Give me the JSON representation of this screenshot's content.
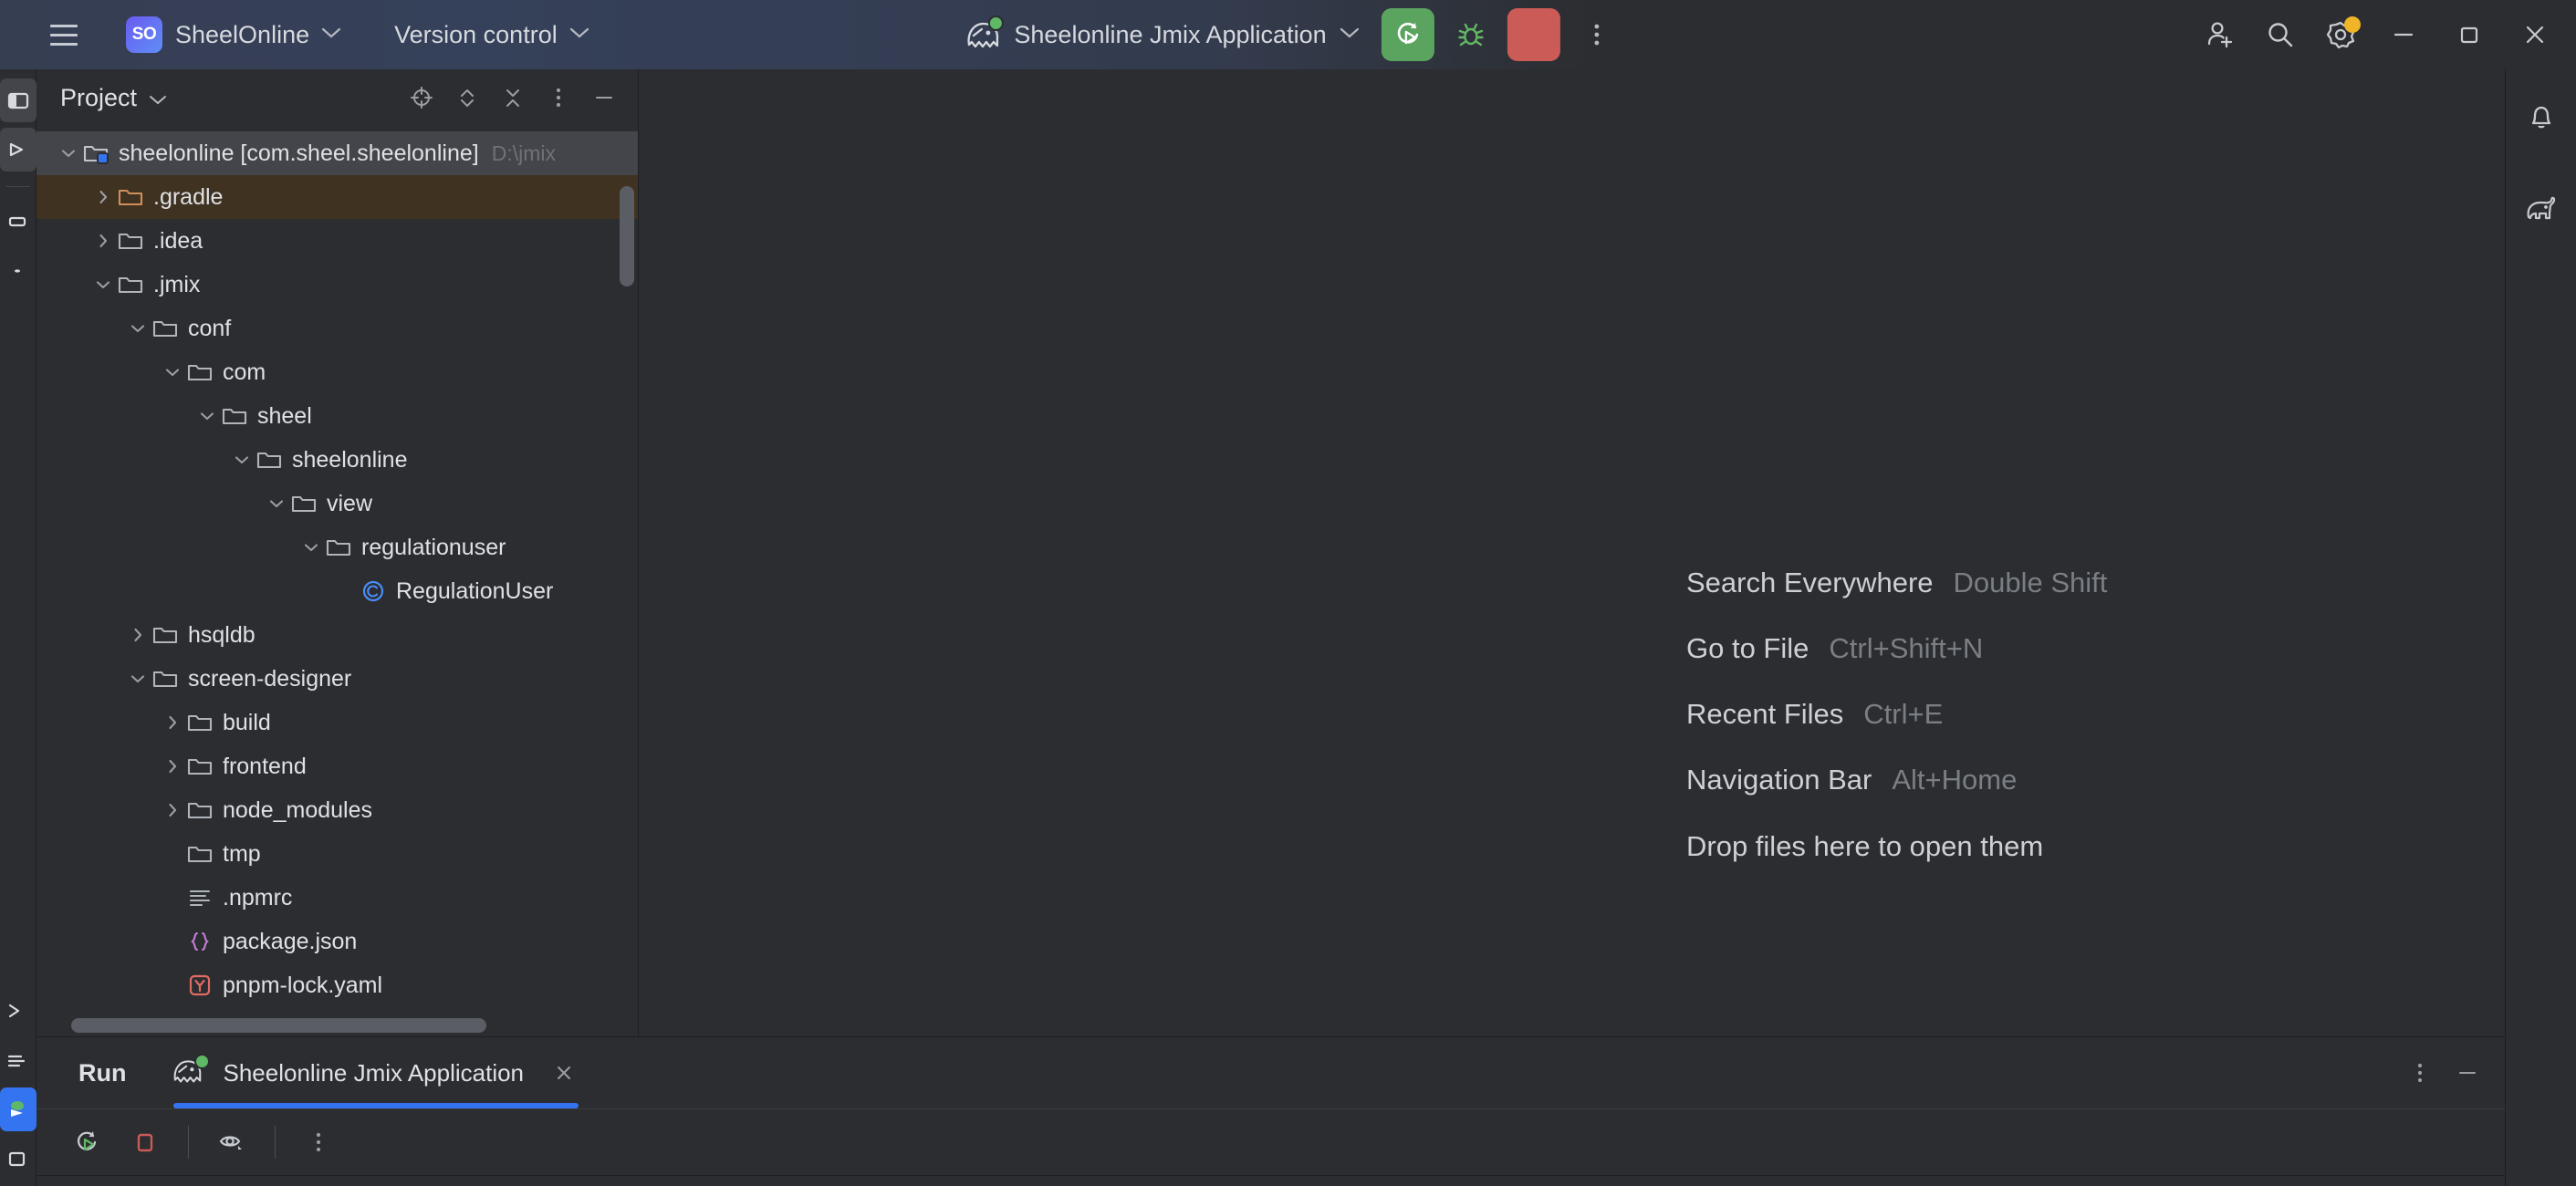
{
  "titlebar": {
    "menu_icon": "hamburger-icon",
    "project_badge": "SO",
    "project_name": "SheelOnline",
    "vcs_label": "Version control",
    "chevron": "⌄",
    "run_config": "Sheelonline Jmix Application",
    "run_config_icon": "jmix-ghost-icon",
    "run_button": "rerun-icon",
    "debug_button": "debug-bug-icon",
    "stop_button": "stop-icon",
    "more_button": "more-vertical-icon",
    "account_button": "add-account-icon",
    "search_button": "search-icon",
    "settings_button": "gear-icon",
    "minimize": "minimize-icon",
    "maximize": "maximize-icon",
    "close": "close-icon",
    "colors": {
      "run_green": "#5ba45f",
      "stop_red": "#cb5b56",
      "debug_green": "#5fb865",
      "gear_badge": "#f0b429",
      "badge_gradient_from": "#6a5bf0",
      "badge_gradient_to": "#5f8ef7"
    }
  },
  "project_panel": {
    "title": "Project",
    "tools": [
      "locate-icon",
      "expand-collapse-icon",
      "collapse-all-icon",
      "options-menu-icon",
      "hide-icon"
    ],
    "tree": [
      {
        "label": "sheelonline [com.sheel.sheelonline]",
        "sub": "D:\\jmix",
        "depth": 0,
        "state": "expanded",
        "icon": "module-folder-icon",
        "selected": true
      },
      {
        "label": ".gradle",
        "depth": 1,
        "state": "collapsed",
        "icon": "excluded-folder-icon",
        "marked": true
      },
      {
        "label": ".idea",
        "depth": 1,
        "state": "collapsed",
        "icon": "folder-icon"
      },
      {
        "label": ".jmix",
        "depth": 1,
        "state": "expanded",
        "icon": "folder-icon"
      },
      {
        "label": "conf",
        "depth": 2,
        "state": "expanded",
        "icon": "folder-icon"
      },
      {
        "label": "com",
        "depth": 3,
        "state": "expanded",
        "icon": "folder-icon"
      },
      {
        "label": "sheel",
        "depth": 4,
        "state": "expanded",
        "icon": "folder-icon"
      },
      {
        "label": "sheelonline",
        "depth": 5,
        "state": "expanded",
        "icon": "folder-icon"
      },
      {
        "label": "view",
        "depth": 6,
        "state": "expanded",
        "icon": "folder-icon"
      },
      {
        "label": "regulationuser",
        "depth": 7,
        "state": "expanded",
        "icon": "folder-icon"
      },
      {
        "label": "RegulationUser",
        "depth": 8,
        "state": "leaf",
        "icon": "java-class-icon"
      },
      {
        "label": "hsqldb",
        "depth": 2,
        "state": "collapsed",
        "icon": "folder-icon"
      },
      {
        "label": "screen-designer",
        "depth": 2,
        "state": "expanded",
        "icon": "folder-icon"
      },
      {
        "label": "build",
        "depth": 3,
        "state": "collapsed",
        "icon": "folder-icon"
      },
      {
        "label": "frontend",
        "depth": 3,
        "state": "collapsed",
        "icon": "folder-icon"
      },
      {
        "label": "node_modules",
        "depth": 3,
        "state": "collapsed",
        "icon": "folder-icon"
      },
      {
        "label": "tmp",
        "depth": 3,
        "state": "leaf",
        "icon": "folder-icon"
      },
      {
        "label": ".npmrc",
        "depth": 3,
        "state": "leaf",
        "icon": "config-lines-icon"
      },
      {
        "label": "package.json",
        "depth": 3,
        "state": "leaf",
        "icon": "json-braces-icon"
      },
      {
        "label": "pnpm-lock.yaml",
        "depth": 3,
        "state": "leaf",
        "icon": "yaml-file-icon"
      }
    ]
  },
  "editor": {
    "hints": [
      {
        "name": "Search Everywhere",
        "key": "Double Shift"
      },
      {
        "name": "Go to File",
        "key": "Ctrl+Shift+N"
      },
      {
        "name": "Recent Files",
        "key": "Ctrl+E"
      },
      {
        "name": "Navigation Bar",
        "key": "Alt+Home"
      }
    ],
    "drop_text": "Drop files here to open them"
  },
  "run_window": {
    "title": "Run",
    "tab_label": "Sheelonline Jmix Application",
    "tab_icon": "jmix-ghost-icon",
    "tab_close": "close-icon",
    "toolbar": [
      "rerun-icon",
      "stop-icon",
      "print-filter-eye-icon",
      "more-vertical-icon"
    ],
    "header_tools": [
      "options-menu-icon",
      "hide-icon"
    ],
    "accent": "#3574f0"
  },
  "right_stripe": {
    "items": [
      "notifications-bell-icon",
      "gradle-elephant-icon"
    ]
  }
}
